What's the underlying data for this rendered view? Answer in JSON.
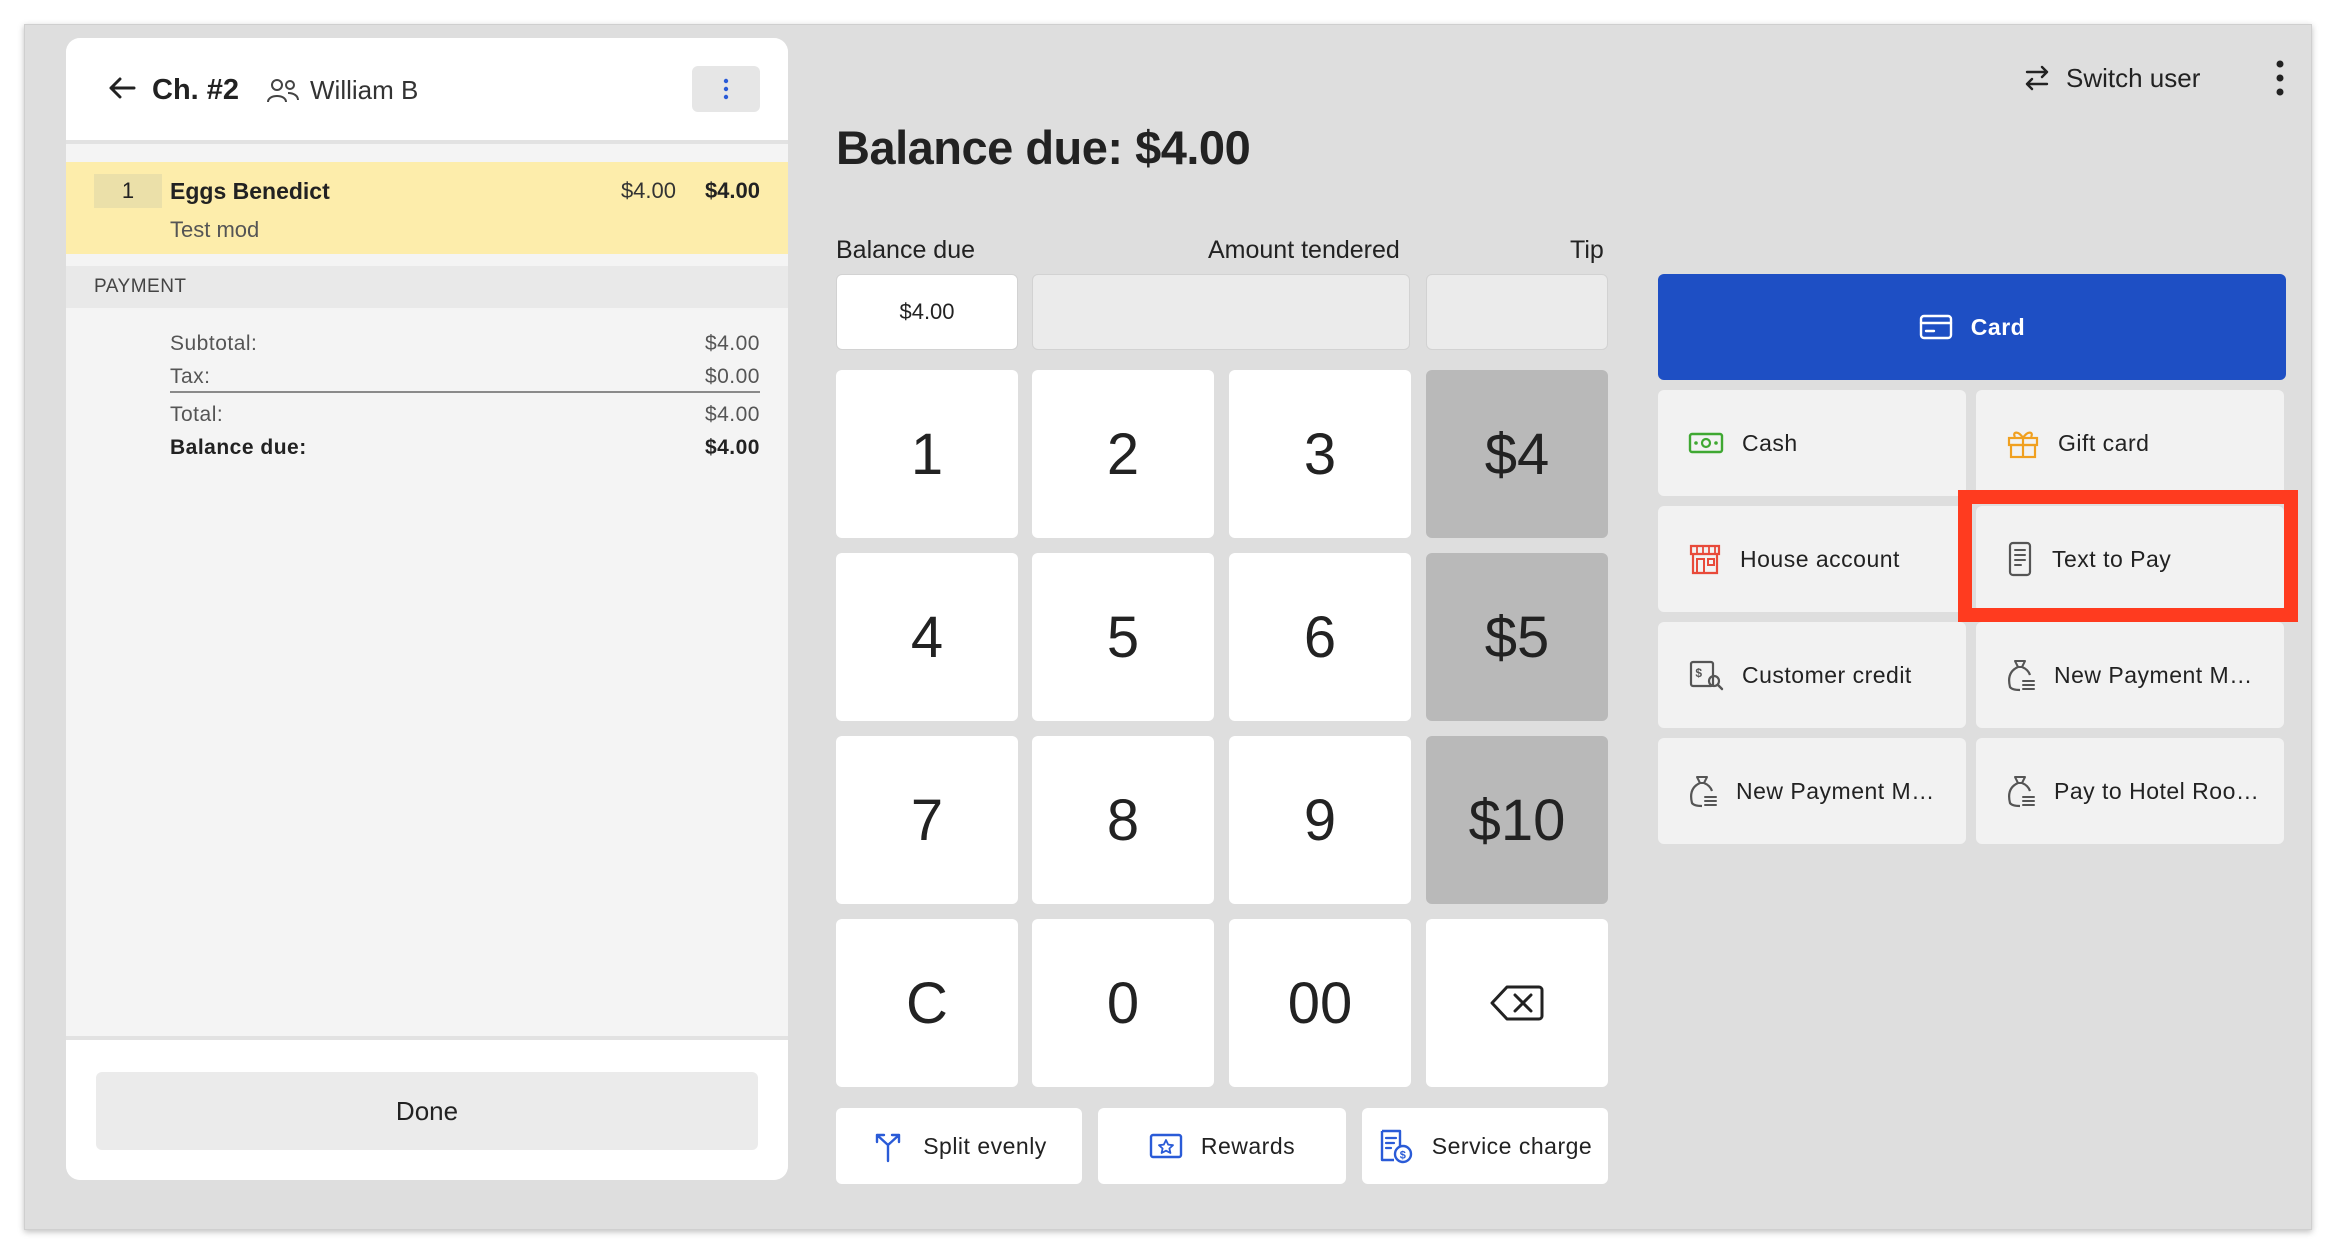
{
  "check": {
    "title": "Ch. #2",
    "server": "William B",
    "items": [
      {
        "qty": "1",
        "name": "Eggs Benedict",
        "price": "$4.00",
        "total": "$4.00",
        "modifier": "Test mod"
      }
    ],
    "payment_heading": "PAYMENT",
    "totals": {
      "subtotal_label": "Subtotal:",
      "subtotal": "$4.00",
      "tax_label": "Tax:",
      "tax": "$0.00",
      "total_label": "Total:",
      "total": "$4.00",
      "balance_label": "Balance due:",
      "balance": "$4.00"
    },
    "done_label": "Done"
  },
  "header": {
    "switch_user_label": "Switch user",
    "balance_title": "Balance due: $4.00"
  },
  "fields": {
    "balance_due_label": "Balance due",
    "balance_due_value": "$4.00",
    "amount_tendered_label": "Amount tendered",
    "amount_tendered_value": "",
    "tip_label": "Tip",
    "tip_value": ""
  },
  "keypad": {
    "k1": "1",
    "k2": "2",
    "k3": "3",
    "k4": "4",
    "k5": "5",
    "k6": "6",
    "k7": "7",
    "k8": "8",
    "k9": "9",
    "clear": "C",
    "k0": "0",
    "k00": "00",
    "quick": [
      "$4",
      "$5",
      "$10"
    ]
  },
  "actions": {
    "split": "Split evenly",
    "rewards": "Rewards",
    "service": "Service charge"
  },
  "tenders": {
    "card": "Card",
    "cash": "Cash",
    "gift": "Gift card",
    "house": "House account",
    "text_to_pay": "Text to Pay",
    "customer_credit": "Customer credit",
    "new_payment_1": "New Payment M…",
    "new_payment_2": "New Payment M…",
    "hotel": "Pay to Hotel Roo…"
  },
  "colors": {
    "card_blue": "#1e4fc4",
    "highlight_red": "#ff3b1f",
    "item_yellow": "#fdedab",
    "cash_green": "#3fa832",
    "gift_orange": "#f0a020",
    "house_red": "#e84a3a"
  }
}
